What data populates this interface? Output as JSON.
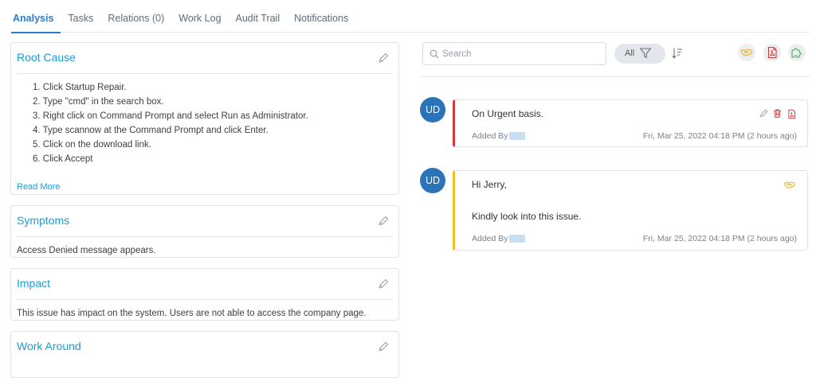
{
  "tabs": [
    {
      "label": "Analysis",
      "active": true
    },
    {
      "label": "Tasks",
      "active": false
    },
    {
      "label": "Relations (0)",
      "active": false
    },
    {
      "label": "Work Log",
      "active": false
    },
    {
      "label": "Audit Trail",
      "active": false
    },
    {
      "label": "Notifications",
      "active": false
    }
  ],
  "cards": {
    "root_cause": {
      "title": "Root Cause",
      "steps": [
        "1. Click Startup Repair.",
        "2. Type \"cmd\" in the search box.",
        "3. Right click on Command Prompt and select Run as Administrator.",
        "4. Type scannow at the Command Prompt and click Enter.",
        "5. Click on the download link.",
        "6. Click Accept"
      ],
      "read_more": "Read More"
    },
    "symptoms": {
      "title": "Symptoms",
      "body": "Access Denied message appears."
    },
    "impact": {
      "title": "Impact",
      "body": "This issue has impact on the system. Users are not able to access the company page."
    },
    "work_around": {
      "title": "Work Around",
      "body": ""
    }
  },
  "toolbar": {
    "search_placeholder": "Search",
    "filter_label": "All",
    "icons": [
      "handshake-icon",
      "pdf-icon",
      "puzzle-icon"
    ]
  },
  "entries": [
    {
      "avatar": "UD",
      "text_lines": [
        "On Urgent basis."
      ],
      "added_by": "Added By",
      "timestamp": "Fri, Mar 25, 2022 04:18 PM (2 hours ago)",
      "accent": "#d23b3b",
      "icons": [
        "pencil-icon",
        "trash-icon",
        "pdf-icon"
      ]
    },
    {
      "avatar": "UD",
      "text_lines": [
        "Hi Jerry,",
        "Kindly look into this issue."
      ],
      "added_by": "Added By",
      "timestamp": "Fri, Mar 25, 2022 04:18 PM (2 hours ago)",
      "accent": "#f2c025",
      "icons": [
        "handshake-icon"
      ]
    }
  ],
  "colors": {
    "accent_blue": "#2a7ec7",
    "title_blue": "#1e9bd3",
    "avatar_blue": "#2a73b8",
    "pdf_red": "#d23b3b",
    "handshake_yellow": "#e9b11c",
    "puzzle_green": "#4caf50"
  }
}
